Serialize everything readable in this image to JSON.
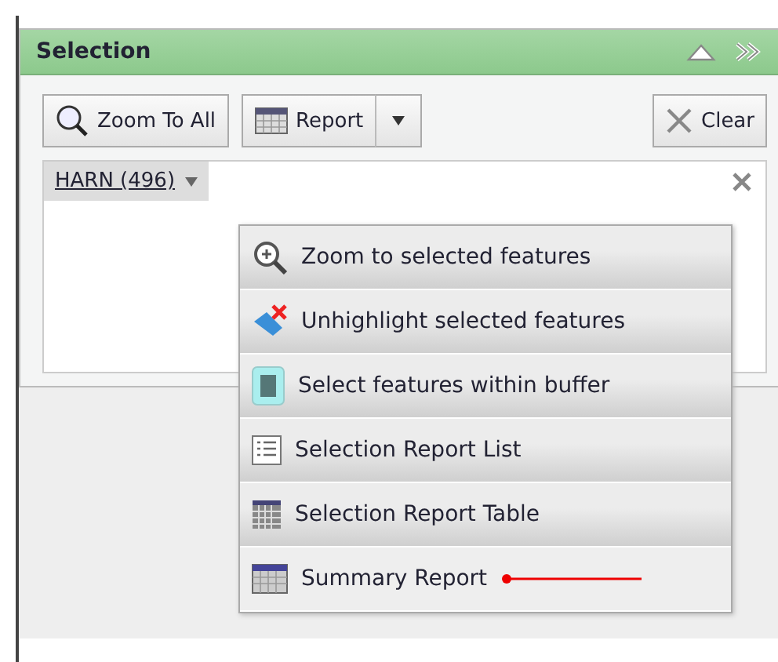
{
  "panel": {
    "title": "Selection"
  },
  "toolbar": {
    "zoom_button": "Zoom To All",
    "report_button": "Report",
    "clear_button": "Clear"
  },
  "selection": {
    "tag": "HARN (496)"
  },
  "menu": [
    {
      "kind": "zoom",
      "label": "Zoom to selected features",
      "selected": false
    },
    {
      "kind": "unhighlight",
      "label": "Unhighlight selected features",
      "selected": false
    },
    {
      "kind": "buffer",
      "label": "Select features within buffer",
      "selected": false
    },
    {
      "kind": "list",
      "label": "Selection Report List",
      "selected": false
    },
    {
      "kind": "table",
      "label": "Selection Report Table",
      "selected": false
    },
    {
      "kind": "summary",
      "label": "Summary Report",
      "selected": true
    }
  ]
}
